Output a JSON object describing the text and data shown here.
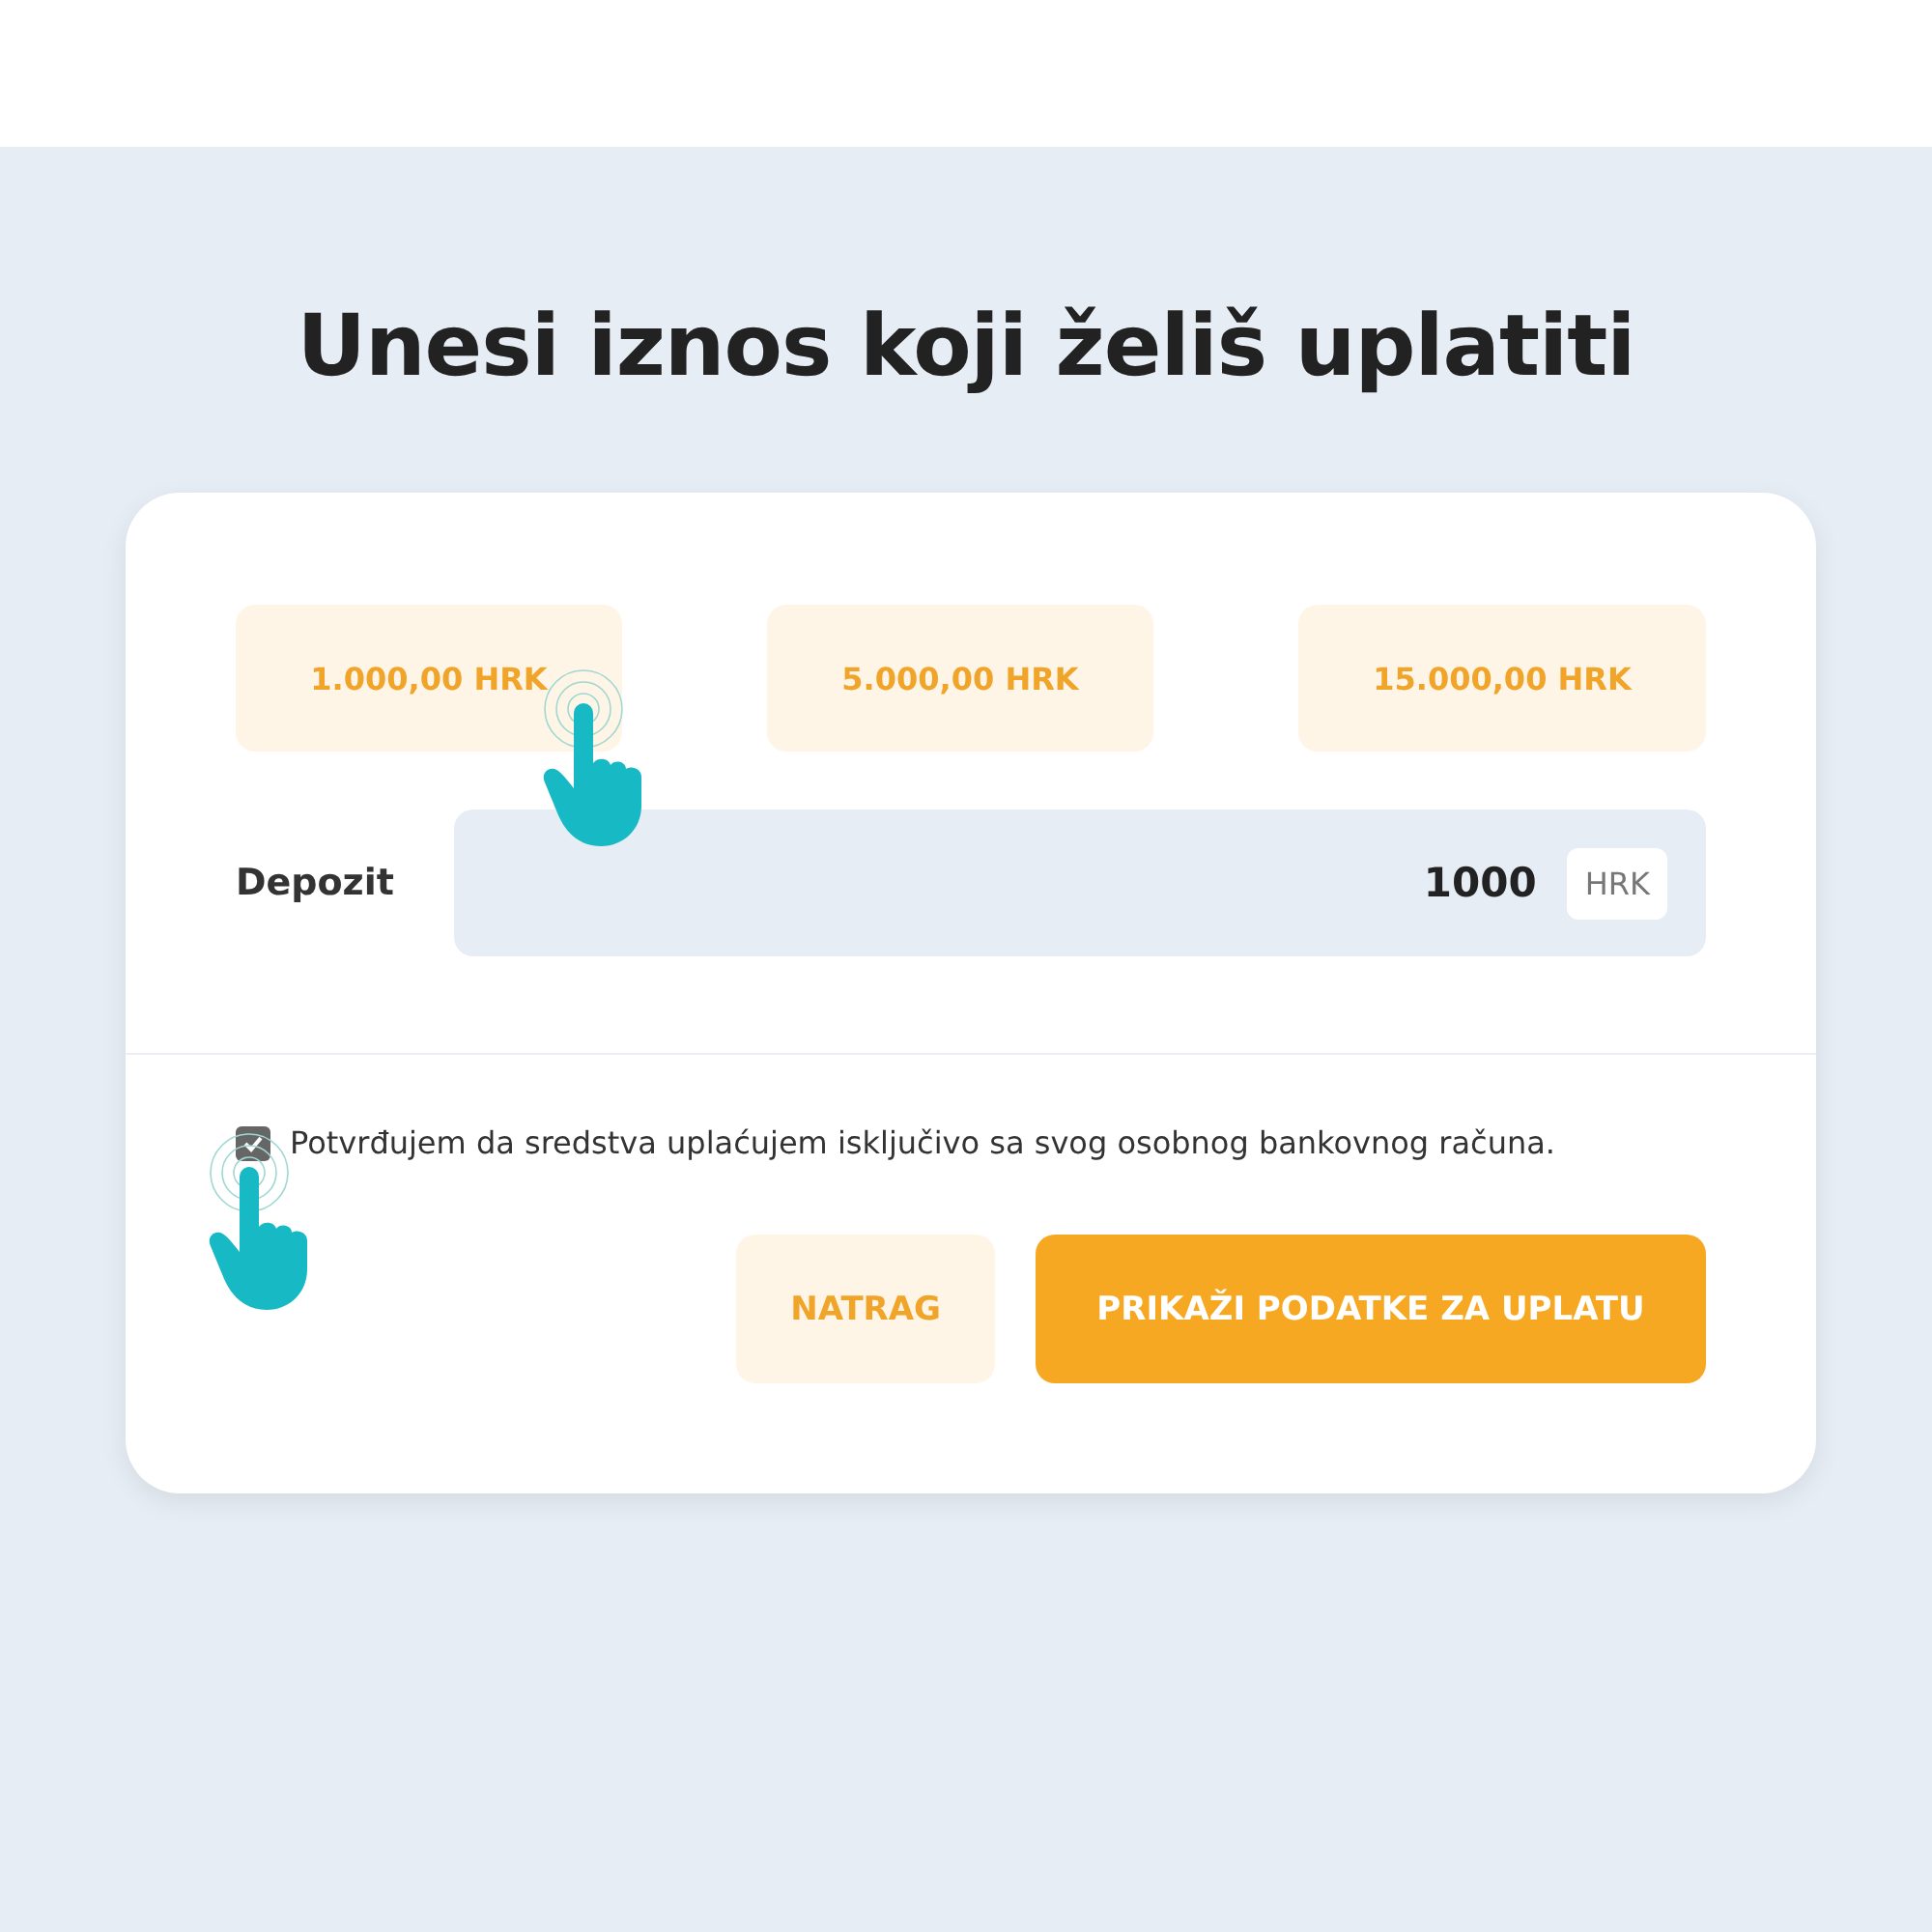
{
  "title": "Unesi iznos koji želiš uplatiti",
  "presets": [
    "1.000,00 HRK",
    "5.000,00 HRK",
    "15.000,00 HRK"
  ],
  "deposit": {
    "label": "Depozit",
    "value": "1000",
    "currency": "HRK"
  },
  "consent": {
    "checked": true,
    "text": "Potvrđujem da sredstva uplaćujem isključivo sa svog osobnog bankovnog računa."
  },
  "buttons": [
    {
      "label": "NATRAG",
      "kind": "secondary"
    },
    {
      "label": "PRIKAŽI PODATKE ZA UPLATU",
      "kind": "primary"
    }
  ]
}
